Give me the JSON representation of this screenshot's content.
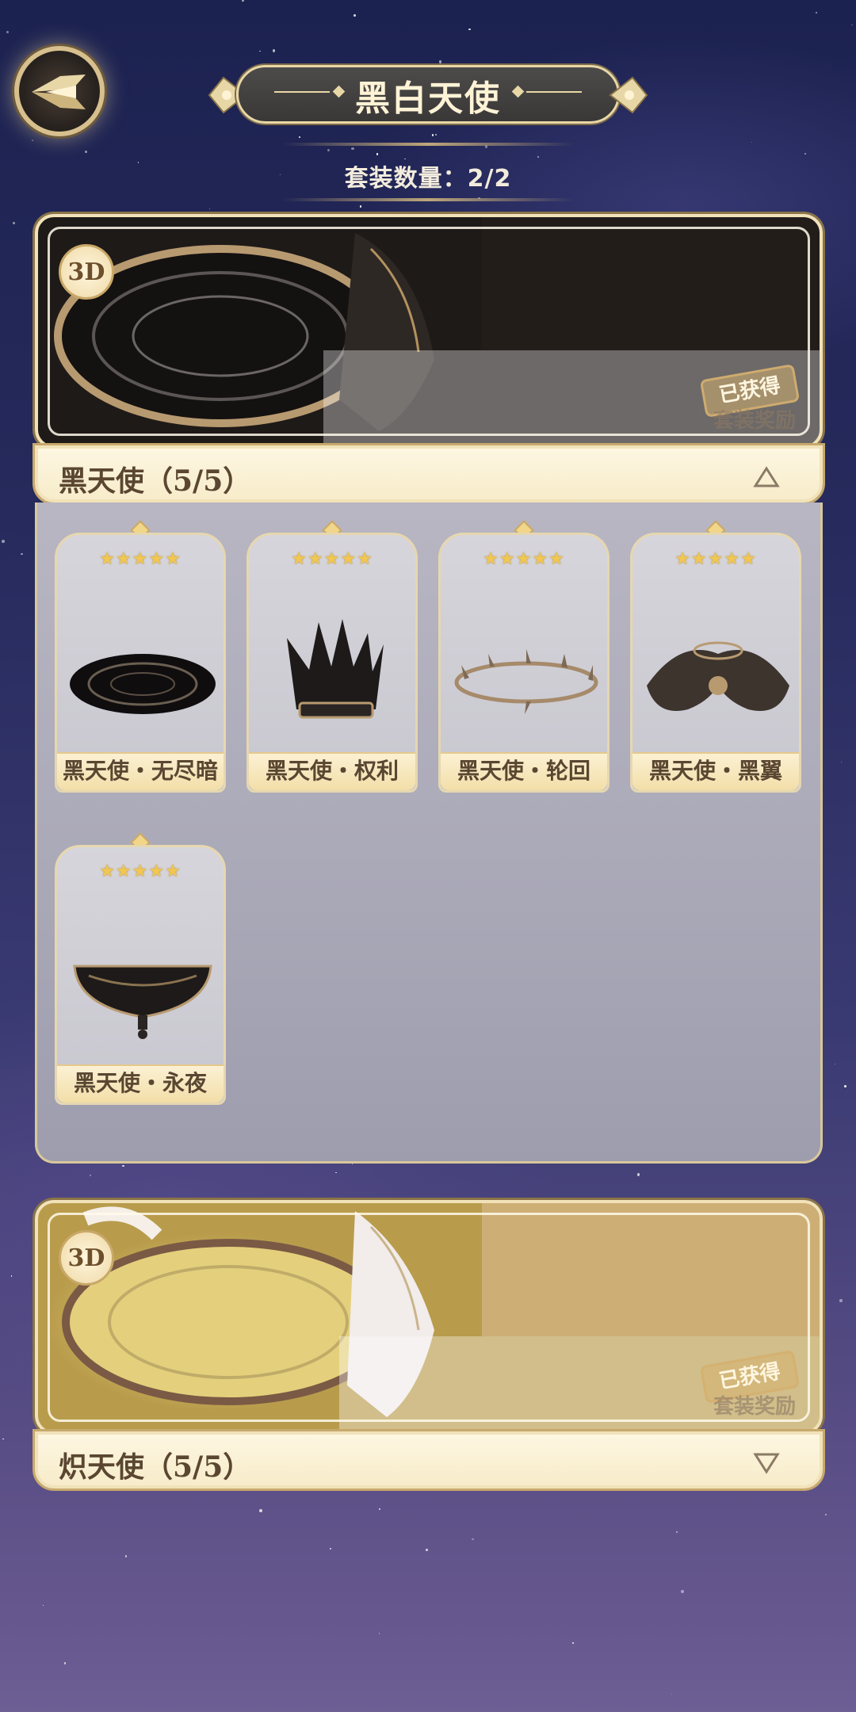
{
  "header": {
    "title": "黑白天使",
    "set_count_label": "套装数量：2/2"
  },
  "back_button": {
    "icon": "back-wing-icon"
  },
  "sets": [
    {
      "badge": "3D",
      "stamp": "已获得",
      "stamp_sub": "套装奖励",
      "label": "黑天使（5/5）",
      "expanded": true,
      "toggle_icon": "collapse-triangle-icon",
      "items": [
        {
          "stars": "★★★★★",
          "name": "黑天使・无尽暗"
        },
        {
          "stars": "★★★★★",
          "name": "黑天使・权利"
        },
        {
          "stars": "★★★★★",
          "name": "黑天使・轮回"
        },
        {
          "stars": "★★★★★",
          "name": "黑天使・黑翼"
        },
        {
          "stars": "★★★★★",
          "name": "黑天使・永夜"
        }
      ]
    },
    {
      "badge": "3D",
      "stamp": "已获得",
      "stamp_sub": "套装奖励",
      "label": "炽天使（5/5）",
      "expanded": false,
      "toggle_icon": "expand-triangle-icon",
      "items": []
    }
  ],
  "colors": {
    "accent_gold": "#e8d7a6",
    "label_text": "#5a4631",
    "star": "#f1c752"
  }
}
